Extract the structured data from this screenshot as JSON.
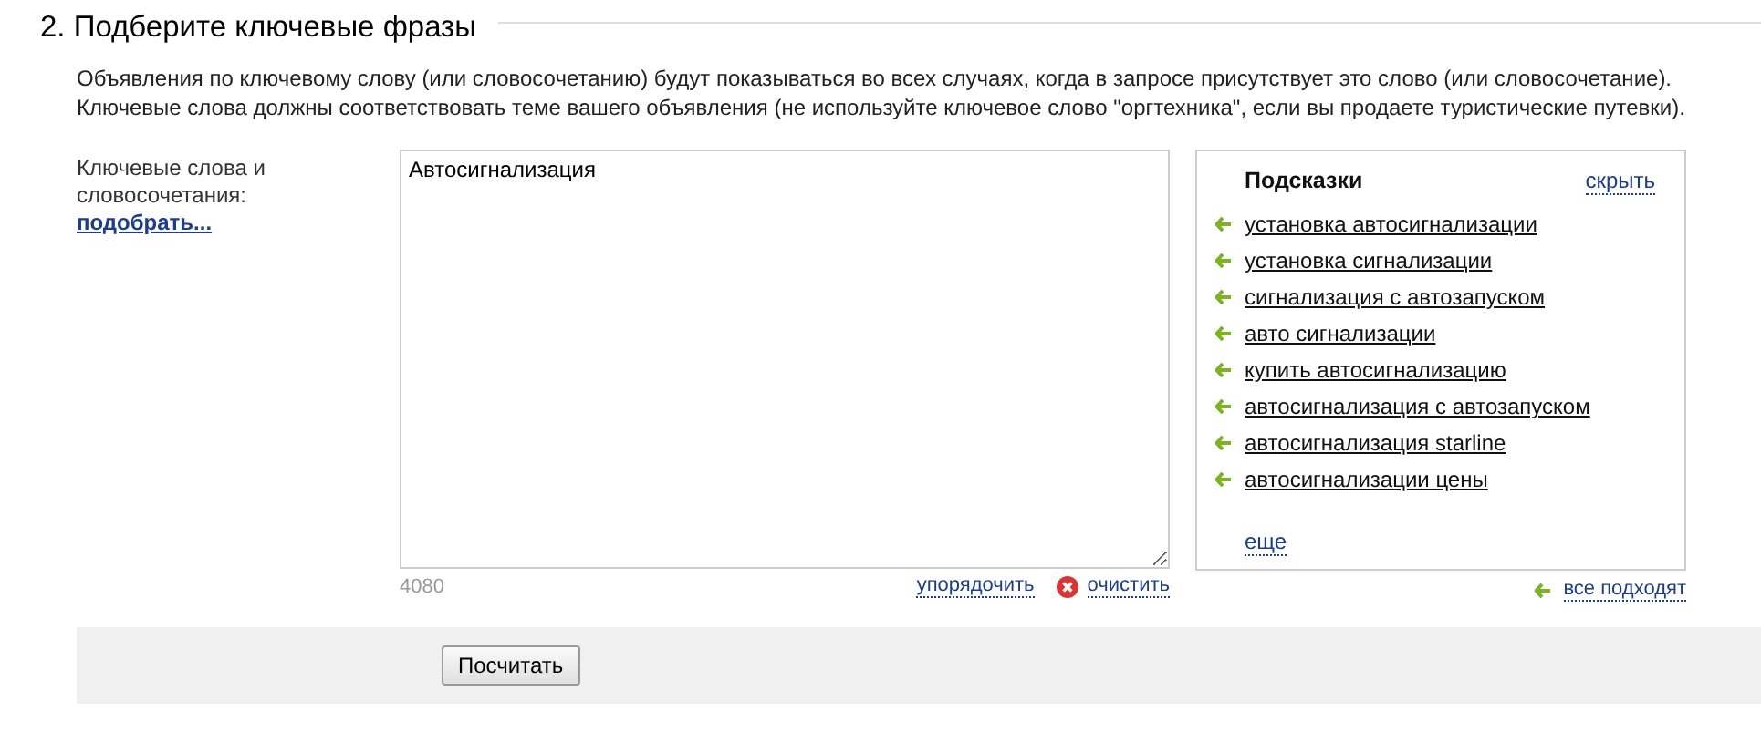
{
  "heading": "2. Подберите ключевые фразы",
  "description": "Объявления по ключевому слову (или словосочетанию) будут показываться во всех случаях, когда в запросе присутствует это слово (или словосочетание). Ключевые слова должны соответствовать теме вашего объявления (не используйте ключевое слово \"оргтехника\", если вы продаете туристические путевки).",
  "field_label": "Ключевые слова и словосочетания:",
  "pick_link": "подобрать...",
  "keywords_value": "Автосигнализация",
  "char_counter": "4080",
  "sort_link": "упорядочить",
  "clear_link": "очистить",
  "hints": {
    "title": "Подсказки",
    "hide_link": "скрыть",
    "items": [
      {
        "label": "установка автосигнализации"
      },
      {
        "label": "установка сигнализации"
      },
      {
        "label": "сигнализация с автозапуском"
      },
      {
        "label": "авто сигнализации"
      },
      {
        "label": "купить автосигнализацию"
      },
      {
        "label": "автосигнализация с автозапуском"
      },
      {
        "label": "автосигнализация starline"
      },
      {
        "label": "автосигнализации цены"
      }
    ],
    "more_link": "еще"
  },
  "all_fit_link": "все подходят",
  "calculate_button": "Посчитать"
}
